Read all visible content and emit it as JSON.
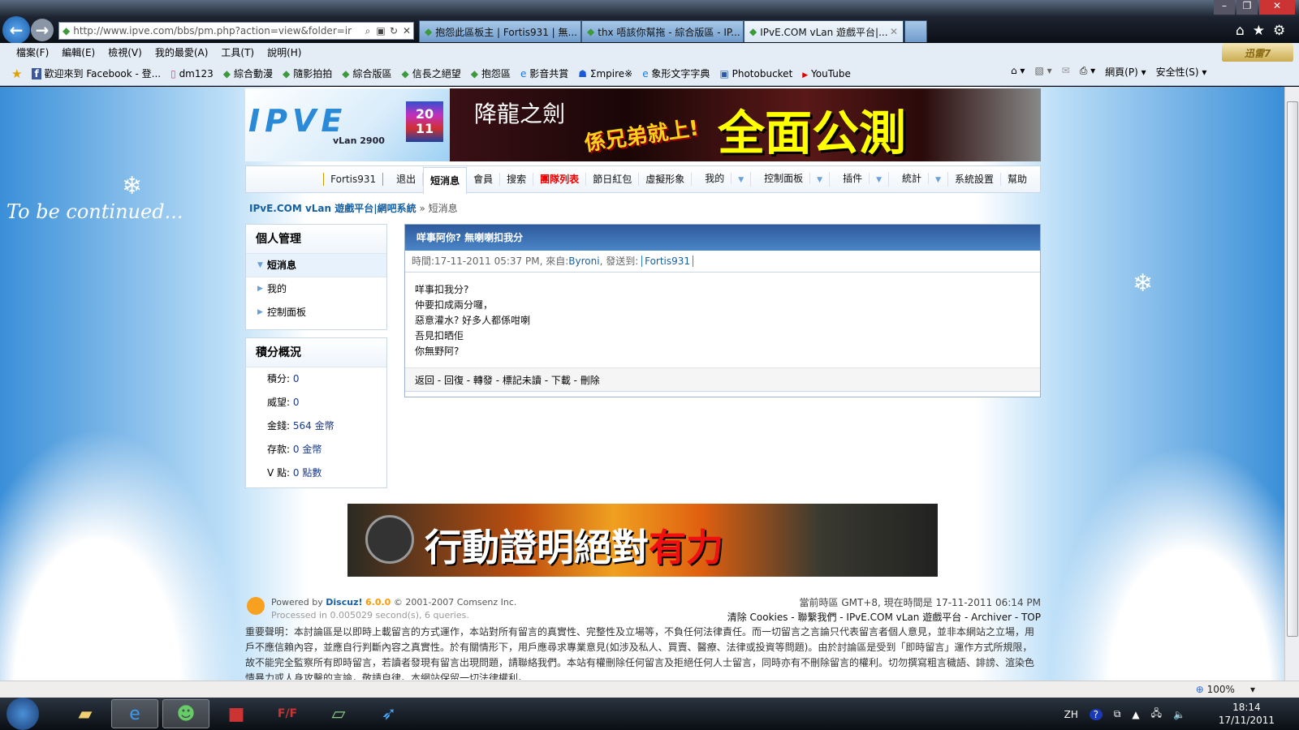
{
  "browser": {
    "url": "http://www.ipve.com/bbs/pm.php?action=view&folder=ir",
    "tabs": [
      {
        "label": "抱怨此區板主 | Fortis931 | 無..."
      },
      {
        "label": "thx 唔該你幫拖 - 綜合版區 - IP..."
      },
      {
        "label": "IPvE.COM vLan 遊戲平台|...",
        "active": true
      }
    ],
    "menu": [
      "檔案(F)",
      "編輯(E)",
      "檢視(V)",
      "我的最愛(A)",
      "工具(T)",
      "說明(H)"
    ],
    "favorites": [
      "歡迎來到 Facebook - 登...",
      "dm123",
      "綜合動漫",
      "隨影拍拍",
      "綜合版區",
      "信長之絕望",
      "抱怨區",
      "影音共賞",
      "Σmpire※",
      "象形文字字典",
      "Photobucket",
      "YouTube"
    ],
    "commands": [
      "網頁(P) ▾",
      "安全性(S) ▾"
    ],
    "addon": "迅雷7",
    "zoom": "100%"
  },
  "site": {
    "logo": {
      "text": "IPVE",
      "sub": "vLan 2900",
      "year": "20 11"
    },
    "banner": {
      "game": "降龍之劍",
      "slogan": "係兄弟就上!",
      "headline": "全面公測"
    },
    "nav": {
      "user": "Fortis931",
      "items": [
        "退出",
        "短消息",
        "會員",
        "搜索",
        "團隊列表",
        "節日紅包",
        "虛擬形象",
        "我的",
        "控制面板",
        "插件",
        "統計",
        "系統設置",
        "幫助"
      ],
      "active": "短消息"
    },
    "breadcrumb": {
      "home": "IPvE.COM vLan 遊戲平台|網吧系統",
      "sep": "»",
      "current": "短消息"
    },
    "sidebar": {
      "manage_title": "個人管理",
      "manage_items": [
        "短消息",
        "我的",
        "控制面板"
      ],
      "credits_title": "積分概況",
      "credits": [
        {
          "label": "積分:",
          "value": "0"
        },
        {
          "label": "威望:",
          "value": "0"
        },
        {
          "label": "金錢:",
          "value": "564 金幣"
        },
        {
          "label": "存款:",
          "value": "0 金幣"
        },
        {
          "label": "V 點:",
          "value": "0 點數"
        }
      ]
    },
    "message": {
      "subject": "咩事阿你? 無喇喇扣我分",
      "time_label": "時間:",
      "time": "17-11-2011 05:37 PM,",
      "from_label": "來自:",
      "from": "Byroni",
      "to_label": ", 發送到:",
      "to": "Fortis931",
      "body": [
        "咩事扣我分?",
        "仲要扣成兩分囉，",
        "惡意灌水? 好多人都係咁喇",
        "吾見扣晒佢",
        "你無野阿?"
      ],
      "actions": "返回 - 回復 - 轉發 - 標記未讀 - 下載 - 刪除"
    },
    "ad": {
      "text1": "行動證明絕對",
      "text2": "有力"
    },
    "footer": {
      "powered": "Powered by",
      "brand": "Discuz!",
      "version": "6.0.0",
      "copyright": "© 2001-2007 Comsenz Inc.",
      "processed": "Processed in 0.005029 second(s), 6 queries.",
      "timezone": "當前時區 GMT+8, 現在時間是 17-11-2011 06:14 PM",
      "links": "清除 Cookies - 聯繫我們 - IPvE.COM vLan 遊戲平台 - Archiver - TOP",
      "disclaimer": "重要聲明：本討論區是以即時上載留言的方式運作，本站對所有留言的真實性、完整性及立場等，不負任何法律責任。而一切留言之言論只代表留言者個人意見，並非本網站之立場，用戶不應信賴內容，並應自行判斷內容之真實性。於有關情形下，用戶應尋求專業意見(如涉及私人、買賣、醫療、法律或投資等問題)。由於討論區是受到「即時留言」運作方式所規限，故不能完全監察所有即時留言，若讀者發現有留言出現問題，請聯絡我們。本站有權刪除任何留言及拒絕任何人士留言，同時亦有不刪除留言的權利。切勿撰寫粗言穢語、誹謗、渲染色情暴力或人身攻擊的言論，敬請自律。本網站保留一切法律權利。"
    },
    "decoration": "To be continued..."
  },
  "taskbar": {
    "lang": "ZH",
    "time": "18:14",
    "date": "17/11/2011"
  }
}
